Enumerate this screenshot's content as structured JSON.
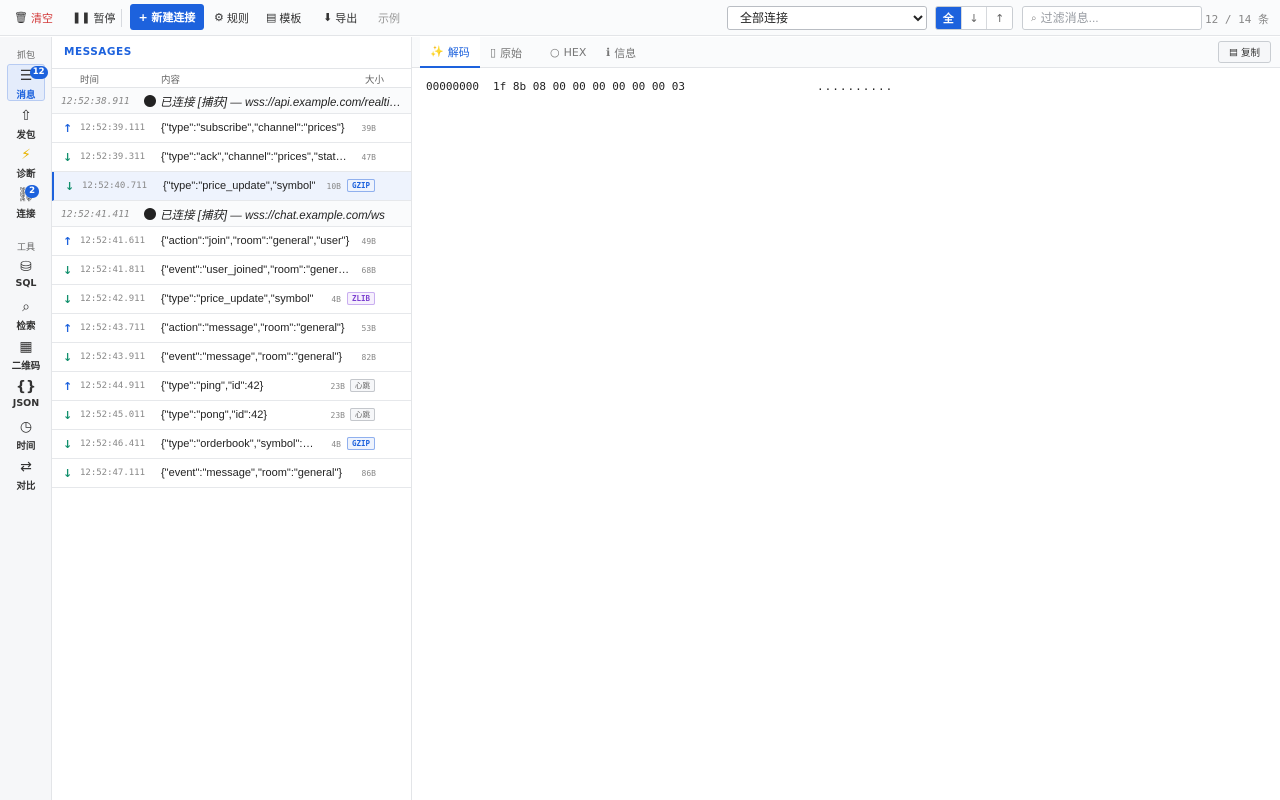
{
  "toolbar": {
    "clear_label": "清空",
    "pause_label": "暂停",
    "new_conn_label": "+ 新建连接",
    "rules_label": "规则",
    "template_label": "模板",
    "export_label": "导出",
    "example_label": "示例",
    "conn_select_value": "全部连接",
    "dir_all": "全",
    "dir_down": "↓",
    "dir_up": "↑",
    "filter_placeholder": "过滤消息...",
    "counter": "12 / 14 条"
  },
  "nav": {
    "section_capture": "抓包",
    "section_tools": "工具",
    "items": [
      {
        "label": "消息",
        "badge": "12"
      },
      {
        "label": "发包"
      },
      {
        "label": "诊断"
      },
      {
        "label": "连接",
        "badge": "2"
      },
      {
        "label": "SQL"
      },
      {
        "label": "检索"
      },
      {
        "label": "二维码"
      },
      {
        "label": "JSON"
      },
      {
        "label": "时间"
      },
      {
        "label": "对比"
      }
    ]
  },
  "messages": {
    "title": "MESSAGES",
    "col_time": "时间",
    "col_content": "内容",
    "col_size": "大小",
    "rows": [
      {
        "kind": "conn",
        "time": "12:52:38.911",
        "content": "已连接 [捕获] — wss://api.example.com/realtime"
      },
      {
        "kind": "msg",
        "dir": "up",
        "time": "12:52:39.111",
        "content": "{\"type\":\"subscribe\",\"channel\":\"prices\"}",
        "size": "39B"
      },
      {
        "kind": "msg",
        "dir": "down",
        "time": "12:52:39.311",
        "content": "{\"type\":\"ack\",\"channel\":\"prices\",\"status\":\"ok\"}",
        "size": "47B"
      },
      {
        "kind": "msg",
        "dir": "down",
        "time": "12:52:40.711",
        "content": "{\"type\":\"price_update\",\"symbol\"",
        "size": "10B",
        "tag": "GZIP",
        "tag_type": "gzip",
        "selected": true
      },
      {
        "kind": "conn",
        "time": "12:52:41.411",
        "content": "已连接 [捕获] — wss://chat.example.com/ws"
      },
      {
        "kind": "msg",
        "dir": "up",
        "time": "12:52:41.611",
        "content": "{\"action\":\"join\",\"room\":\"general\",\"user\"}",
        "size": "49B"
      },
      {
        "kind": "msg",
        "dir": "down",
        "time": "12:52:41.811",
        "content": "{\"event\":\"user_joined\",\"room\":\"general\"}",
        "size": "68B"
      },
      {
        "kind": "msg",
        "dir": "down",
        "time": "12:52:42.911",
        "content": "{\"type\":\"price_update\",\"symbol\"",
        "size": "4B",
        "tag": "ZLIB",
        "tag_type": "zlib"
      },
      {
        "kind": "msg",
        "dir": "up",
        "time": "12:52:43.711",
        "content": "{\"action\":\"message\",\"room\":\"general\"}",
        "size": "53B"
      },
      {
        "kind": "msg",
        "dir": "down",
        "time": "12:52:43.911",
        "content": "{\"event\":\"message\",\"room\":\"general\"}",
        "size": "82B"
      },
      {
        "kind": "msg",
        "dir": "up",
        "time": "12:52:44.911",
        "content": "{\"type\":\"ping\",\"id\":42}",
        "size": "23B",
        "tag": "心跳",
        "tag_type": "hb"
      },
      {
        "kind": "msg",
        "dir": "down",
        "time": "12:52:45.011",
        "content": "{\"type\":\"pong\",\"id\":42}",
        "size": "23B",
        "tag": "心跳",
        "tag_type": "hb"
      },
      {
        "kind": "msg",
        "dir": "down",
        "time": "12:52:46.411",
        "content": "{\"type\":\"orderbook\",\"symbol\":\"BTC\"}",
        "size": "4B",
        "tag": "GZIP",
        "tag_type": "gzip"
      },
      {
        "kind": "msg",
        "dir": "down",
        "time": "12:52:47.111",
        "content": "{\"event\":\"message\",\"room\":\"general\"}",
        "size": "86B"
      }
    ]
  },
  "detail": {
    "tab_decode": "解码",
    "tab_raw": "原始",
    "tab_hex": "HEX",
    "tab_info": "信息",
    "copy_label": "复制",
    "hex_offset": "00000000",
    "hex_bytes": "1f 8b 08 00 00 00 00 00 00 03",
    "hex_ascii": ".........."
  }
}
